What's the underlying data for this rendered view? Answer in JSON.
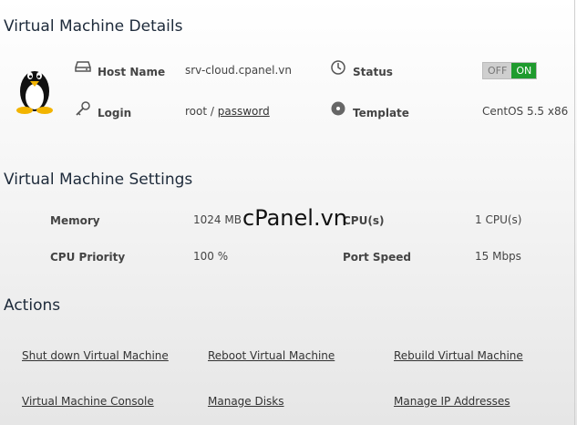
{
  "details": {
    "title": "Virtual Machine Details",
    "hostname_label": "Host Name",
    "hostname_value": "srv-cloud.cpanel.vn",
    "login_label": "Login",
    "login_user": "root",
    "login_sep": "/",
    "login_password_link": "password",
    "status_label": "Status",
    "status_off": "OFF",
    "status_on": "ON",
    "template_label": "Template",
    "template_value": "CentOS 5.5 x86"
  },
  "settings": {
    "title": "Virtual Machine Settings",
    "memory_label": "Memory",
    "memory_value": "1024 MB",
    "cpus_label": "CPU(s)",
    "cpus_value": "1 CPU(s)",
    "cpu_priority_label": "CPU Priority",
    "cpu_priority_value": "100 %",
    "port_speed_label": "Port Speed",
    "port_speed_value": "15 Mbps"
  },
  "actions": {
    "title": "Actions",
    "shutdown": "Shut down Virtual Machine",
    "reboot": "Reboot Virtual Machine",
    "rebuild": "Rebuild Virtual Machine",
    "console": "Virtual Machine Console",
    "disks": "Manage Disks",
    "ip": "Manage IP Addresses"
  },
  "watermark": "cPanel.vn",
  "colors": {
    "on": "#1f9b2e",
    "off": "#cfcfcf",
    "title": "#1d2a3a"
  },
  "icons": [
    "linux-penguin-icon",
    "server-icon",
    "key-icon",
    "clock-icon",
    "disc-icon"
  ]
}
